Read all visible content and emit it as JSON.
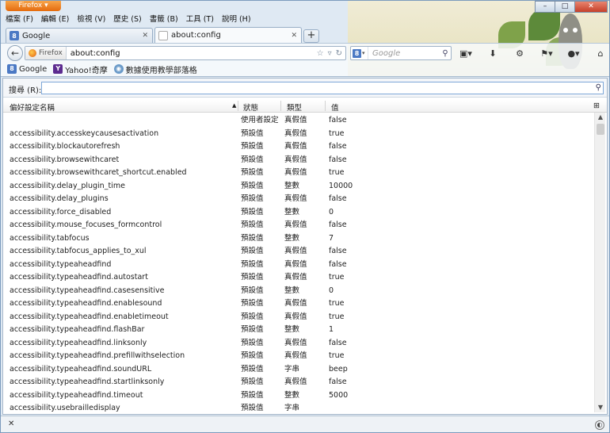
{
  "window": {
    "app_button": "Firefox",
    "controls": [
      "–",
      "□",
      "✕"
    ]
  },
  "menubar": {
    "items": [
      "檔案 (F)",
      "編輯 (E)",
      "檢視 (V)",
      "歷史 (S)",
      "書籤 (B)",
      "工具 (T)",
      "說明 (H)"
    ]
  },
  "tabs": [
    {
      "label": "Google",
      "active": false
    },
    {
      "label": "about:config",
      "active": true
    }
  ],
  "newtab_label": "+",
  "navbar": {
    "identity_label": "Firefox",
    "url": "about:config",
    "search_placeholder": "Google"
  },
  "bookmarks": [
    {
      "label": "Google",
      "icon": "google-icon"
    },
    {
      "label": "Yahoo!奇摩",
      "icon": "yahoo-icon"
    },
    {
      "label": "數據使用教學部落格",
      "icon": "globe-icon"
    }
  ],
  "filter": {
    "label": "搜尋 (R):",
    "value": ""
  },
  "columns": {
    "name": "偏好設定名稱",
    "status": "狀態",
    "type": "類型",
    "value": "值"
  },
  "rows": [
    {
      "name": "",
      "status": "使用者設定",
      "type": "真假值",
      "value": "false"
    },
    {
      "name": "accessibility.accesskeycausesactivation",
      "status": "預設值",
      "type": "真假值",
      "value": "true"
    },
    {
      "name": "accessibility.blockautorefresh",
      "status": "預設值",
      "type": "真假值",
      "value": "false"
    },
    {
      "name": "accessibility.browsewithcaret",
      "status": "預設值",
      "type": "真假值",
      "value": "false"
    },
    {
      "name": "accessibility.browsewithcaret_shortcut.enabled",
      "status": "預設值",
      "type": "真假值",
      "value": "true"
    },
    {
      "name": "accessibility.delay_plugin_time",
      "status": "預設值",
      "type": "整數",
      "value": "10000"
    },
    {
      "name": "accessibility.delay_plugins",
      "status": "預設值",
      "type": "真假值",
      "value": "false"
    },
    {
      "name": "accessibility.force_disabled",
      "status": "預設值",
      "type": "整數",
      "value": "0"
    },
    {
      "name": "accessibility.mouse_focuses_formcontrol",
      "status": "預設值",
      "type": "真假值",
      "value": "false"
    },
    {
      "name": "accessibility.tabfocus",
      "status": "預設值",
      "type": "整數",
      "value": "7"
    },
    {
      "name": "accessibility.tabfocus_applies_to_xul",
      "status": "預設值",
      "type": "真假值",
      "value": "false"
    },
    {
      "name": "accessibility.typeaheadfind",
      "status": "預設值",
      "type": "真假值",
      "value": "false"
    },
    {
      "name": "accessibility.typeaheadfind.autostart",
      "status": "預設值",
      "type": "真假值",
      "value": "true"
    },
    {
      "name": "accessibility.typeaheadfind.casesensitive",
      "status": "預設值",
      "type": "整數",
      "value": "0"
    },
    {
      "name": "accessibility.typeaheadfind.enablesound",
      "status": "預設值",
      "type": "真假值",
      "value": "true"
    },
    {
      "name": "accessibility.typeaheadfind.enabletimeout",
      "status": "預設值",
      "type": "真假值",
      "value": "true"
    },
    {
      "name": "accessibility.typeaheadfind.flashBar",
      "status": "預設值",
      "type": "整數",
      "value": "1"
    },
    {
      "name": "accessibility.typeaheadfind.linksonly",
      "status": "預設值",
      "type": "真假值",
      "value": "false"
    },
    {
      "name": "accessibility.typeaheadfind.prefillwithselection",
      "status": "預設值",
      "type": "真假值",
      "value": "true"
    },
    {
      "name": "accessibility.typeaheadfind.soundURL",
      "status": "預設值",
      "type": "字串",
      "value": "beep"
    },
    {
      "name": "accessibility.typeaheadfind.startlinksonly",
      "status": "預設值",
      "type": "真假值",
      "value": "false"
    },
    {
      "name": "accessibility.typeaheadfind.timeout",
      "status": "預設值",
      "type": "整數",
      "value": "5000"
    },
    {
      "name": "accessibility.usebrailledisplay",
      "status": "預設值",
      "type": "字串",
      "value": ""
    }
  ],
  "statusbar": {
    "close_label": "✕"
  }
}
